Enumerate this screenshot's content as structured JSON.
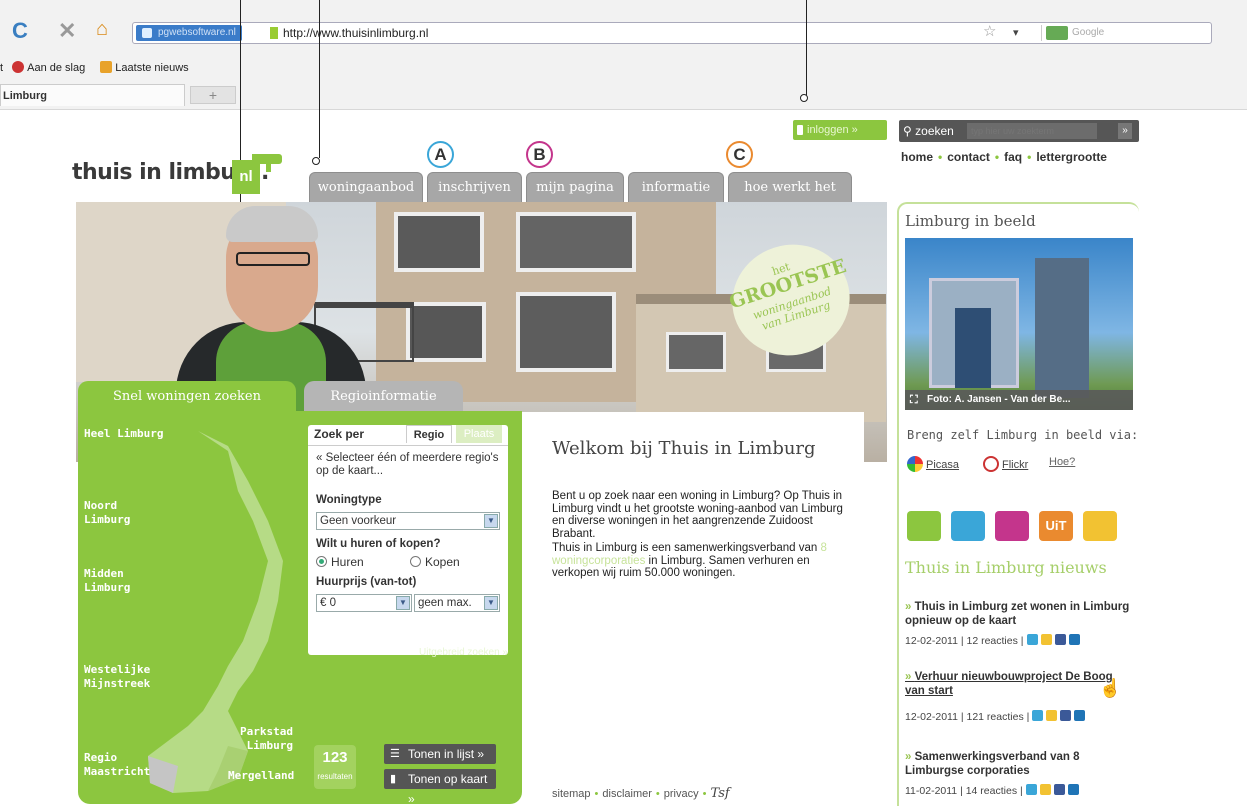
{
  "browser": {
    "identity": "pgwebsoftware.nl",
    "url": "http://www.thuisinlimburg.nl",
    "search_placeholder": "Google",
    "bookmarks": [
      "Aan de slag",
      "Laatste nieuws"
    ],
    "tab_title": "Limburg",
    "newtab": "+"
  },
  "site": {
    "logo_text": "thuis in limburg.",
    "logo_nl": "nl",
    "login": "inloggen »",
    "search_label": "zoeken",
    "search_placeholder": "typ hier uw zoekterm",
    "search_go": "»",
    "toplinks": [
      "home",
      "contact",
      "faq",
      "lettergrootte"
    ],
    "menu": [
      "woningaanbod",
      "inschrijven",
      "mijn pagina",
      "informatie",
      "hoe werkt het"
    ],
    "markers": [
      "A",
      "B",
      "C"
    ],
    "colors": {
      "green": "#8cc63f",
      "marker_a": "#3aa6d8",
      "marker_b": "#c4358c",
      "marker_c": "#ea8a2f"
    }
  },
  "hero": {
    "badge": [
      "het",
      "GROOTSTE",
      "woningaanbod",
      "van Limburg"
    ]
  },
  "panel": {
    "tab_snel": "Snel woningen zoeken",
    "tab_regio": "Regioinformatie",
    "regions": [
      {
        "label": "Heel Limburg"
      },
      {
        "label": "Noord\nLimburg"
      },
      {
        "label": "Midden\nLimburg"
      },
      {
        "label": "Westelijke\nMijnstreek"
      },
      {
        "label": "Parkstad\nLimburg"
      },
      {
        "label": "Regio\nMaastricht"
      },
      {
        "label": "Mergelland"
      }
    ],
    "zoek_per": "Zoek per",
    "tab_regio_small": "Regio",
    "tab_plaats": "Plaats",
    "select_hint": "« Selecteer één of meerdere regio's op de kaart...",
    "woningtype_label": "Woningtype",
    "woningtype_value": "Geen voorkeur",
    "huren_kopen_label": "Wilt u huren of kopen?",
    "huren": "Huren",
    "kopen": "Kopen",
    "prijs_label": "Huurprijs (van-tot)",
    "prijs_min": "€ 0",
    "prijs_max": "geen max.",
    "uitgebreid": "Uitgebreid zoeken »",
    "count": "123",
    "count_label": "resultaten",
    "btn_lijst": "Tonen in lijst »",
    "btn_kaart": "Tonen op kaart »"
  },
  "welcome": {
    "title": "Welkom bij Thuis in Limburg",
    "p1": "Bent u op zoek naar een woning in Limburg? Op Thuis in Limburg vindt u het grootste woning-aanbod van Limburg en diverse woningen in het aangrenzende Zuidoost Brabant.",
    "p2_a": "Thuis in Limburg is een samenwerkingsverband van",
    "p2_link": "8 woningcorporaties",
    "p2_b": "in Limburg. Samen verhuren en verkopen wij ruim 50.000 woningen.",
    "footer": [
      "sitemap",
      "disclaimer",
      "privacy"
    ],
    "footer_sig": "Tsf"
  },
  "right": {
    "lib_title": "Limburg in beeld",
    "photo_caption": "Foto: A. Jansen - Van der Be...",
    "breng": "Breng zelf Limburg in beeld via:",
    "picasa": "Picasa",
    "flickr": "Flickr",
    "hoe": "Hoe?",
    "cat_icons": [
      "",
      "",
      "",
      "UiT",
      ""
    ],
    "news_title": "Thuis in Limburg nieuws",
    "news": [
      {
        "title": "Thuis in Limburg zet wonen in Limburg opnieuw op de kaart",
        "meta": "12-02-2011 | 12 reacties |"
      },
      {
        "title": "Verhuur nieuwbouwproject De Boog van start",
        "meta": "12-02-2011 | 121 reacties |"
      },
      {
        "title": "Samenwerkingsverband van 8 Limburgse corporaties",
        "meta": "11-02-2011 | 14 reacties |"
      }
    ]
  }
}
